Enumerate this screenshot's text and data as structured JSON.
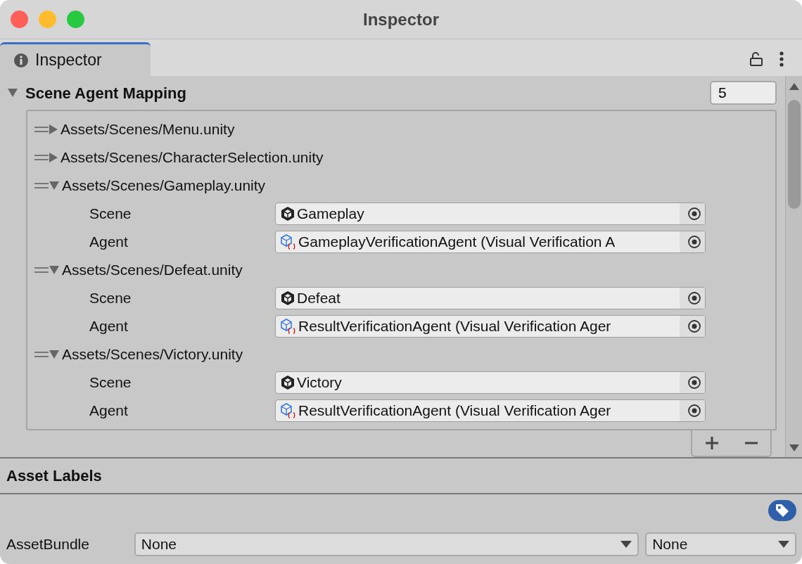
{
  "window": {
    "title": "Inspector"
  },
  "tabs": [
    {
      "label": "Inspector",
      "selected": true
    }
  ],
  "component": {
    "title": "Scene Agent Mapping",
    "expanded": true,
    "count": "5",
    "items": [
      {
        "path": "Assets/Scenes/Menu.unity",
        "expanded": false
      },
      {
        "path": "Assets/Scenes/CharacterSelection.unity",
        "expanded": false
      },
      {
        "path": "Assets/Scenes/Gameplay.unity",
        "expanded": true,
        "fields": [
          {
            "label": "Scene",
            "value": "Gameplay",
            "kind": "scene"
          },
          {
            "label": "Agent",
            "value": "GameplayVerificationAgent (Visual Verification A",
            "kind": "script"
          }
        ]
      },
      {
        "path": "Assets/Scenes/Defeat.unity",
        "expanded": true,
        "fields": [
          {
            "label": "Scene",
            "value": "Defeat",
            "kind": "scene"
          },
          {
            "label": "Agent",
            "value": "ResultVerificationAgent (Visual Verification Ager",
            "kind": "script"
          }
        ]
      },
      {
        "path": "Assets/Scenes/Victory.unity",
        "expanded": true,
        "fields": [
          {
            "label": "Scene",
            "value": "Victory",
            "kind": "scene"
          },
          {
            "label": "Agent",
            "value": "ResultVerificationAgent (Visual Verification Ager",
            "kind": "script"
          }
        ]
      }
    ]
  },
  "asset_labels": {
    "title": "Asset Labels",
    "bundle_label": "AssetBundle",
    "bundle_name": "None",
    "bundle_variant": "None"
  }
}
